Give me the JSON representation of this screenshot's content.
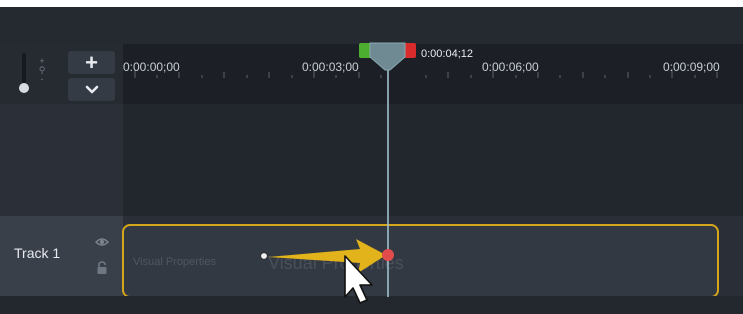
{
  "toolbar": {
    "zoom_in_label": "+",
    "zoom_in_icon": "plus-icon",
    "zoom_menu_icon": "chevron-down-icon",
    "zoom_icon": "magnifier-icon"
  },
  "ruler": {
    "playhead_time": "0:00:04;12",
    "tick_labels": [
      "0:00:00;00",
      "0:00:03;00",
      "0:00:06;00",
      "0:00:09;00"
    ]
  },
  "tracks": [
    {
      "name": "Track 1",
      "visibility_icon": "eye-icon",
      "lock_icon": "lock-icon",
      "clip": {
        "label_small": "Visual Properties",
        "label_large": "Visual Properties"
      }
    }
  ],
  "annotation": {
    "icon": "arrow-annotation-icon",
    "cursor_icon": "mouse-pointer-icon"
  },
  "colors": {
    "accent_clip": "#d4a61c",
    "playhead": "#6f8a93",
    "in_marker": "#4caf30",
    "out_marker": "#d92b2b",
    "keyframe": "#e24b4b"
  }
}
